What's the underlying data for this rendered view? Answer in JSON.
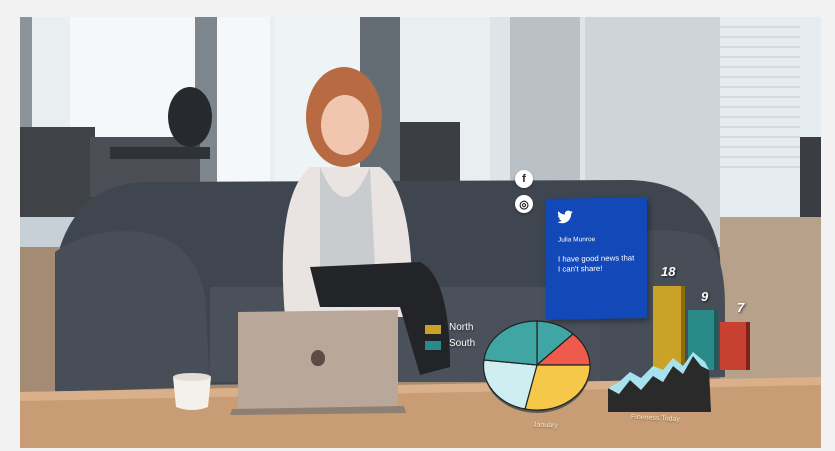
{
  "scene": {
    "description_free": true
  },
  "social_icons": [
    {
      "name": "facebook-icon",
      "glyph": "f"
    },
    {
      "name": "instagram-icon",
      "glyph": "◎"
    }
  ],
  "tweet": {
    "icon": "twitter-bird-icon",
    "author": "Julia Munroe",
    "text": "I have good news that I can't share!",
    "background": "#1348b8"
  },
  "legend": [
    {
      "label": "North",
      "color": "#c9a227"
    },
    {
      "label": "South",
      "color": "#2a8a87"
    }
  ],
  "bar_chart": {
    "values": [
      18,
      9,
      7
    ],
    "labels": [
      "18",
      "9",
      "7"
    ],
    "colors": [
      "#c9a227",
      "#2a8a87",
      "#c8402f"
    ]
  },
  "captions": {
    "pie": "January",
    "area": "Fineness Today"
  },
  "colors": {
    "pie_yellow": "#f6c84a",
    "pie_teal": "#3fa6a3",
    "pie_red": "#ee5b4c",
    "pie_light": "#cfeef2"
  }
}
